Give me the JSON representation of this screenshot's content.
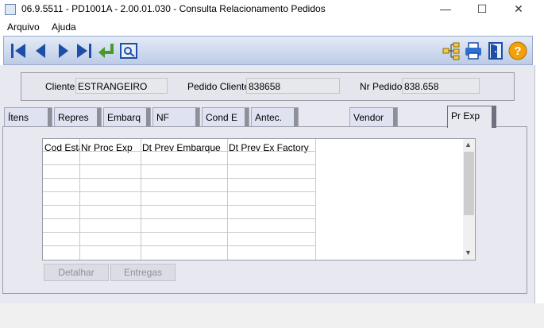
{
  "window": {
    "title": "06.9.5511 - PD1001A - 2.00.01.030 - Consulta Relacionamento Pedidos",
    "min_glyph": "—",
    "max_glyph": "☐",
    "close_glyph": "✕"
  },
  "menu": {
    "items": [
      "Arquivo",
      "Ajuda"
    ]
  },
  "toolbar": {
    "icons": [
      "first-record-icon",
      "previous-record-icon",
      "next-record-icon",
      "last-record-icon",
      "return-icon",
      "view-icon",
      "tree-icon",
      "print-icon",
      "exit-door-icon",
      "help-icon"
    ],
    "accent": "#1d4fa8",
    "green": "#4a9a2a",
    "help_color": "#f2a10a",
    "help_label": "?"
  },
  "header": {
    "cliente_label": "Cliente:",
    "cliente_value": "ESTRANGEIRO",
    "pedido_cliente_label": "Pedido Cliente:",
    "pedido_cliente_value": "838658",
    "nr_pedido_label": "Nr Pedido:",
    "nr_pedido_value": "838.658"
  },
  "tabs": [
    "Ítens",
    "Repres",
    "Embarq",
    "NF",
    "Cond E",
    "Antec.",
    "Vendor",
    "Pr Exp"
  ],
  "active_tab": "Pr Exp",
  "grid": {
    "columns": [
      "Cod Esta",
      "Nr Proc Exp",
      "Dt Prev Embarque",
      "Dt Prev Ex Factory"
    ],
    "rows": [],
    "scroll_up": "▲",
    "scroll_down": "▼"
  },
  "buttons": {
    "detalhar": "Detalhar",
    "entregas": "Entregas"
  }
}
